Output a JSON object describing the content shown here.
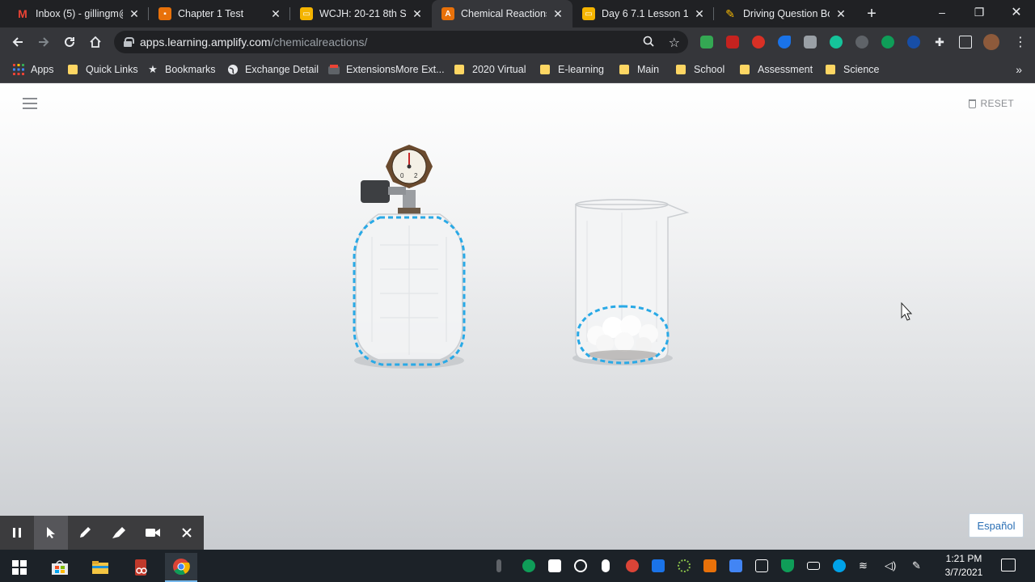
{
  "browser": {
    "tabs": [
      {
        "title": "Inbox (5) - gillingm@",
        "icon": "gmail-icon",
        "color": "#ea4335",
        "active": false
      },
      {
        "title": "Chapter 1 Test",
        "icon": "forms-icon",
        "color": "#e8710a",
        "active": false
      },
      {
        "title": "WCJH: 20-21 8th Scie",
        "icon": "slides-icon",
        "color": "#f4b400",
        "active": false
      },
      {
        "title": "Chemical Reactions",
        "icon": "amplify-icon",
        "color": "#e8710a",
        "active": true
      },
      {
        "title": "Day 6 7.1 Lesson 1 Sl",
        "icon": "slides-icon",
        "color": "#f4b400",
        "active": false
      },
      {
        "title": "Driving Question Bo",
        "icon": "pencil-icon",
        "color": "#fbbc04",
        "active": false
      }
    ],
    "url_host": "apps.learning.amplify.com",
    "url_path": "/chemicalreactions/"
  },
  "bookmarks": [
    {
      "label": "Apps",
      "icon": "apps-grid-icon"
    },
    {
      "label": "Quick Links",
      "icon": "folder-icon"
    },
    {
      "label": "Bookmarks",
      "icon": "star-icon"
    },
    {
      "label": "Exchange Detail",
      "icon": "globe-icon"
    },
    {
      "label": "ExtensionsMore Ext...",
      "icon": "extension-icon"
    },
    {
      "label": "2020 Virtual",
      "icon": "folder-icon"
    },
    {
      "label": "E-learning",
      "icon": "folder-icon"
    },
    {
      "label": "Main",
      "icon": "folder-icon"
    },
    {
      "label": "School",
      "icon": "folder-icon"
    },
    {
      "label": "Assessment",
      "icon": "folder-icon"
    },
    {
      "label": "Science",
      "icon": "folder-icon"
    }
  ],
  "app": {
    "reset_label": "RESET",
    "language_button": "Español",
    "gauge_low": "0",
    "gauge_high": "2",
    "highlight_color": "#29a9e6"
  },
  "taskbar": {
    "time": "1:21 PM",
    "date": "3/7/2021"
  }
}
